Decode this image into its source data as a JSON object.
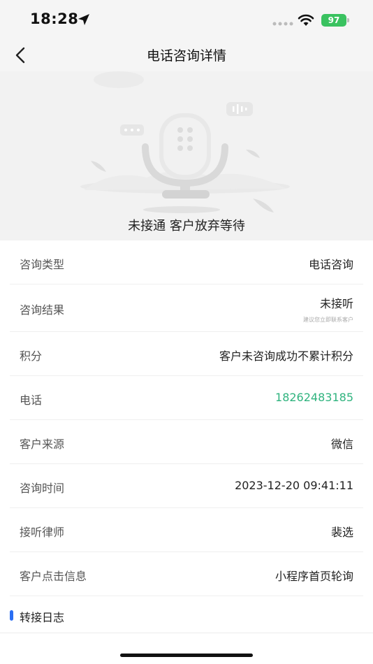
{
  "status_bar": {
    "time": "18:28",
    "battery": "97"
  },
  "nav": {
    "title": "电话咨询详情"
  },
  "hero": {
    "status_text": "未接通 客户放弃等待"
  },
  "details": {
    "consult_type": {
      "label": "咨询类型",
      "value": "电话咨询"
    },
    "consult_result": {
      "label": "咨询结果",
      "value": "未接听",
      "hint": "建议您立即联系客户"
    },
    "points": {
      "label": "积分",
      "value": "客户未咨询成功不累计积分"
    },
    "phone": {
      "label": "电话",
      "value": "18262483185"
    },
    "source": {
      "label": "客户来源",
      "value": "微信"
    },
    "consult_time": {
      "label": "咨询时间",
      "value": "2023-12-20 09:41:11"
    },
    "lawyer": {
      "label": "接听律师",
      "value": "裴选"
    },
    "click_info": {
      "label": "客户点击信息",
      "value": "小程序首页轮询"
    }
  },
  "transfer_log": {
    "title": "转接日志"
  },
  "colors": {
    "phone_green": "#2fb37e",
    "accent_blue": "#2a6ef3",
    "battery_green": "#3ac260"
  }
}
